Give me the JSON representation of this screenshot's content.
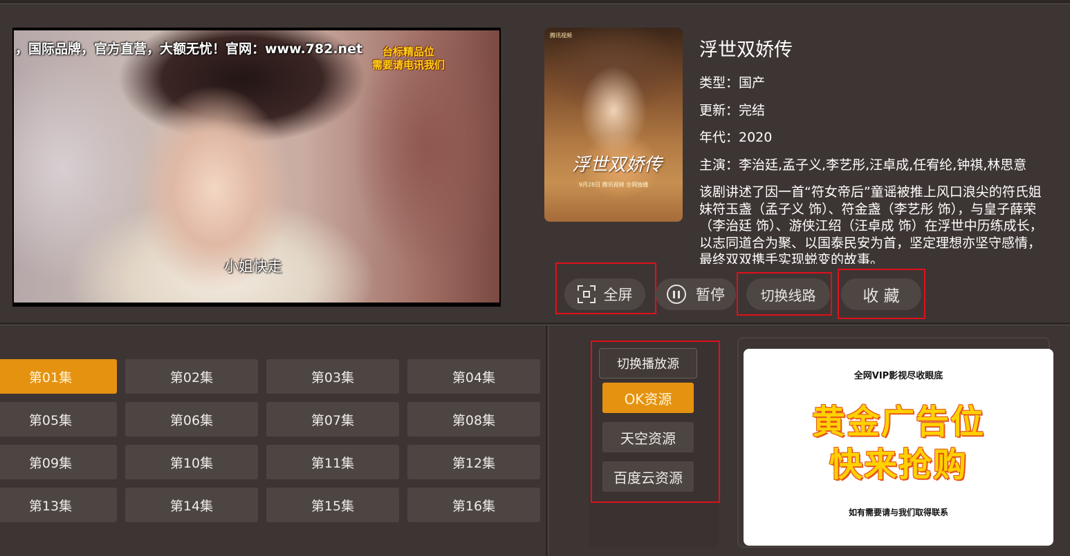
{
  "player": {
    "ad_banner": "，国际品牌，官方直营，大额无忧！官网：www.782.net",
    "ad_slot_line1": "台标精品位",
    "ad_slot_line2": "需要请电讯我们",
    "subtitle": "小姐快走"
  },
  "poster": {
    "title_art": "浮世双娇传",
    "logo_text": "腾讯视频",
    "date_text": "9月28日  腾讯视频  全网独播"
  },
  "details": {
    "title": "浮世双娇传",
    "type": "类型：国产",
    "update": "更新：完结",
    "year": "年代：2020",
    "cast": "主演：李治廷,孟子义,李艺彤,汪卓成,任宥纶,钟祺,林思意",
    "description": "该剧讲述了因一首“符女帝后”童谣被推上风口浪尖的符氏姐妹符玉盏（孟子义 饰）、符金盏（李艺彤 饰），与皇子薛荣（李治廷 饰）、游侠江绍（汪卓成 饰）在浮世中历练成长，以志同道合为聚、以国泰民安为首，坚定理想亦坚守感情，最终双双携手实现蜕变的故事。"
  },
  "controls": {
    "fullscreen": "全屏",
    "pause": "暂停",
    "switch_line": "切换线路",
    "favorite": "收 藏"
  },
  "episodes": [
    "第01集",
    "第02集",
    "第03集",
    "第04集",
    "第05集",
    "第06集",
    "第07集",
    "第08集",
    "第09集",
    "第10集",
    "第11集",
    "第12集",
    "第13集",
    "第14集",
    "第15集",
    "第16集"
  ],
  "active_episode": "第01集",
  "sources": {
    "header": "切换播放源",
    "items": [
      "OK资源",
      "天空资源",
      "百度云资源"
    ],
    "active": "OK资源"
  },
  "ad_panel": {
    "top": "全网VIP影视尽收眼底",
    "line1": "黄金广告位",
    "line2": "快来抢购",
    "bottom": "如有需要请与我们取得联系"
  },
  "colors": {
    "background": "#3d3533",
    "accent": "#e59211",
    "highlight_box": "#e0101c"
  }
}
